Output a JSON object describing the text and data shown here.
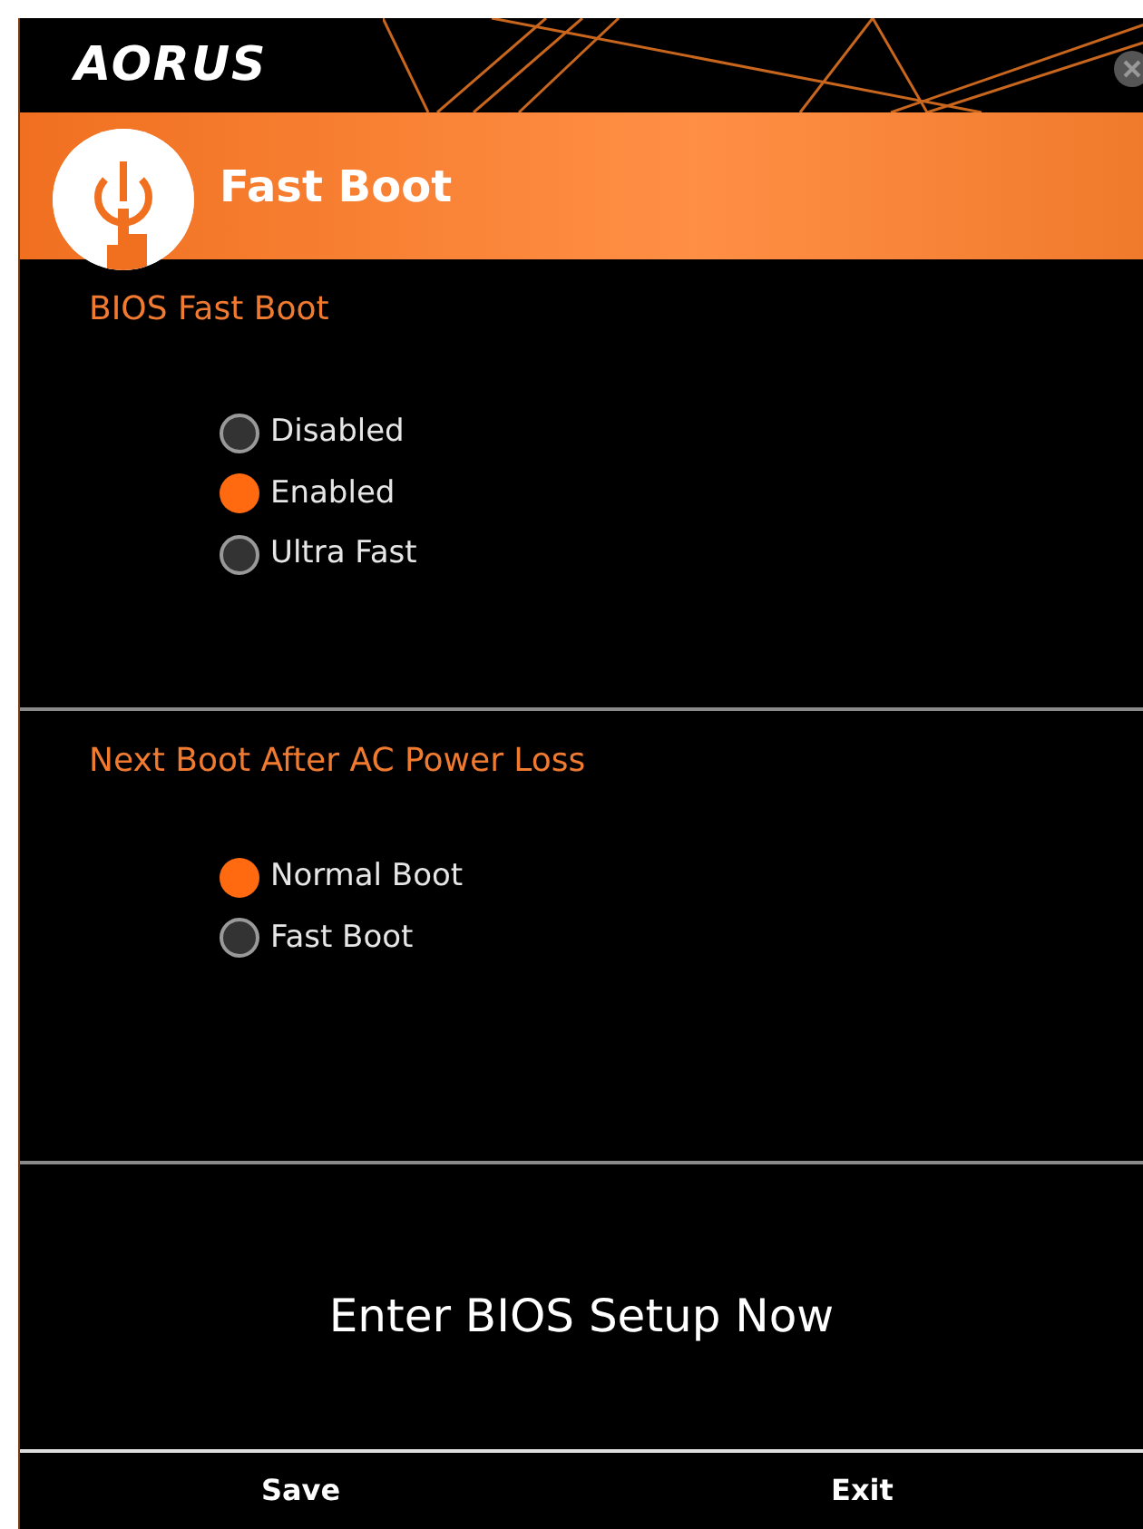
{
  "window": {
    "logo": "AORUS",
    "title": "Fast Boot"
  },
  "sections": [
    {
      "heading": "BIOS Fast Boot",
      "options": [
        {
          "label": "Disabled",
          "selected": false
        },
        {
          "label": "Enabled",
          "selected": true
        },
        {
          "label": "Ultra Fast",
          "selected": false
        }
      ]
    },
    {
      "heading": "Next Boot After AC Power Loss",
      "options": [
        {
          "label": "Normal Boot",
          "selected": true
        },
        {
          "label": "Fast Boot",
          "selected": false
        }
      ]
    }
  ],
  "action": {
    "label": "Enter BIOS Setup Now"
  },
  "buttons": [
    "Save",
    "Exit"
  ]
}
